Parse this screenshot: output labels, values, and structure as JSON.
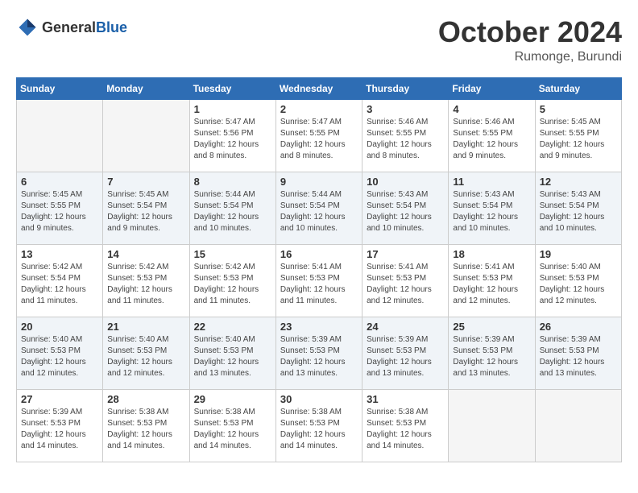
{
  "header": {
    "logo_general": "General",
    "logo_blue": "Blue",
    "month": "October 2024",
    "location": "Rumonge, Burundi"
  },
  "weekdays": [
    "Sunday",
    "Monday",
    "Tuesday",
    "Wednesday",
    "Thursday",
    "Friday",
    "Saturday"
  ],
  "weeks": [
    [
      {
        "day": "",
        "empty": true
      },
      {
        "day": "",
        "empty": true
      },
      {
        "day": "1",
        "sunrise": "Sunrise: 5:47 AM",
        "sunset": "Sunset: 5:56 PM",
        "daylight": "Daylight: 12 hours and 8 minutes."
      },
      {
        "day": "2",
        "sunrise": "Sunrise: 5:47 AM",
        "sunset": "Sunset: 5:55 PM",
        "daylight": "Daylight: 12 hours and 8 minutes."
      },
      {
        "day": "3",
        "sunrise": "Sunrise: 5:46 AM",
        "sunset": "Sunset: 5:55 PM",
        "daylight": "Daylight: 12 hours and 8 minutes."
      },
      {
        "day": "4",
        "sunrise": "Sunrise: 5:46 AM",
        "sunset": "Sunset: 5:55 PM",
        "daylight": "Daylight: 12 hours and 9 minutes."
      },
      {
        "day": "5",
        "sunrise": "Sunrise: 5:45 AM",
        "sunset": "Sunset: 5:55 PM",
        "daylight": "Daylight: 12 hours and 9 minutes."
      }
    ],
    [
      {
        "day": "6",
        "sunrise": "Sunrise: 5:45 AM",
        "sunset": "Sunset: 5:55 PM",
        "daylight": "Daylight: 12 hours and 9 minutes."
      },
      {
        "day": "7",
        "sunrise": "Sunrise: 5:45 AM",
        "sunset": "Sunset: 5:54 PM",
        "daylight": "Daylight: 12 hours and 9 minutes."
      },
      {
        "day": "8",
        "sunrise": "Sunrise: 5:44 AM",
        "sunset": "Sunset: 5:54 PM",
        "daylight": "Daylight: 12 hours and 10 minutes."
      },
      {
        "day": "9",
        "sunrise": "Sunrise: 5:44 AM",
        "sunset": "Sunset: 5:54 PM",
        "daylight": "Daylight: 12 hours and 10 minutes."
      },
      {
        "day": "10",
        "sunrise": "Sunrise: 5:43 AM",
        "sunset": "Sunset: 5:54 PM",
        "daylight": "Daylight: 12 hours and 10 minutes."
      },
      {
        "day": "11",
        "sunrise": "Sunrise: 5:43 AM",
        "sunset": "Sunset: 5:54 PM",
        "daylight": "Daylight: 12 hours and 10 minutes."
      },
      {
        "day": "12",
        "sunrise": "Sunrise: 5:43 AM",
        "sunset": "Sunset: 5:54 PM",
        "daylight": "Daylight: 12 hours and 10 minutes."
      }
    ],
    [
      {
        "day": "13",
        "sunrise": "Sunrise: 5:42 AM",
        "sunset": "Sunset: 5:54 PM",
        "daylight": "Daylight: 12 hours and 11 minutes."
      },
      {
        "day": "14",
        "sunrise": "Sunrise: 5:42 AM",
        "sunset": "Sunset: 5:53 PM",
        "daylight": "Daylight: 12 hours and 11 minutes."
      },
      {
        "day": "15",
        "sunrise": "Sunrise: 5:42 AM",
        "sunset": "Sunset: 5:53 PM",
        "daylight": "Daylight: 12 hours and 11 minutes."
      },
      {
        "day": "16",
        "sunrise": "Sunrise: 5:41 AM",
        "sunset": "Sunset: 5:53 PM",
        "daylight": "Daylight: 12 hours and 11 minutes."
      },
      {
        "day": "17",
        "sunrise": "Sunrise: 5:41 AM",
        "sunset": "Sunset: 5:53 PM",
        "daylight": "Daylight: 12 hours and 12 minutes."
      },
      {
        "day": "18",
        "sunrise": "Sunrise: 5:41 AM",
        "sunset": "Sunset: 5:53 PM",
        "daylight": "Daylight: 12 hours and 12 minutes."
      },
      {
        "day": "19",
        "sunrise": "Sunrise: 5:40 AM",
        "sunset": "Sunset: 5:53 PM",
        "daylight": "Daylight: 12 hours and 12 minutes."
      }
    ],
    [
      {
        "day": "20",
        "sunrise": "Sunrise: 5:40 AM",
        "sunset": "Sunset: 5:53 PM",
        "daylight": "Daylight: 12 hours and 12 minutes."
      },
      {
        "day": "21",
        "sunrise": "Sunrise: 5:40 AM",
        "sunset": "Sunset: 5:53 PM",
        "daylight": "Daylight: 12 hours and 12 minutes."
      },
      {
        "day": "22",
        "sunrise": "Sunrise: 5:40 AM",
        "sunset": "Sunset: 5:53 PM",
        "daylight": "Daylight: 12 hours and 13 minutes."
      },
      {
        "day": "23",
        "sunrise": "Sunrise: 5:39 AM",
        "sunset": "Sunset: 5:53 PM",
        "daylight": "Daylight: 12 hours and 13 minutes."
      },
      {
        "day": "24",
        "sunrise": "Sunrise: 5:39 AM",
        "sunset": "Sunset: 5:53 PM",
        "daylight": "Daylight: 12 hours and 13 minutes."
      },
      {
        "day": "25",
        "sunrise": "Sunrise: 5:39 AM",
        "sunset": "Sunset: 5:53 PM",
        "daylight": "Daylight: 12 hours and 13 minutes."
      },
      {
        "day": "26",
        "sunrise": "Sunrise: 5:39 AM",
        "sunset": "Sunset: 5:53 PM",
        "daylight": "Daylight: 12 hours and 13 minutes."
      }
    ],
    [
      {
        "day": "27",
        "sunrise": "Sunrise: 5:39 AM",
        "sunset": "Sunset: 5:53 PM",
        "daylight": "Daylight: 12 hours and 14 minutes."
      },
      {
        "day": "28",
        "sunrise": "Sunrise: 5:38 AM",
        "sunset": "Sunset: 5:53 PM",
        "daylight": "Daylight: 12 hours and 14 minutes."
      },
      {
        "day": "29",
        "sunrise": "Sunrise: 5:38 AM",
        "sunset": "Sunset: 5:53 PM",
        "daylight": "Daylight: 12 hours and 14 minutes."
      },
      {
        "day": "30",
        "sunrise": "Sunrise: 5:38 AM",
        "sunset": "Sunset: 5:53 PM",
        "daylight": "Daylight: 12 hours and 14 minutes."
      },
      {
        "day": "31",
        "sunrise": "Sunrise: 5:38 AM",
        "sunset": "Sunset: 5:53 PM",
        "daylight": "Daylight: 12 hours and 14 minutes."
      },
      {
        "day": "",
        "empty": true
      },
      {
        "day": "",
        "empty": true
      }
    ]
  ]
}
